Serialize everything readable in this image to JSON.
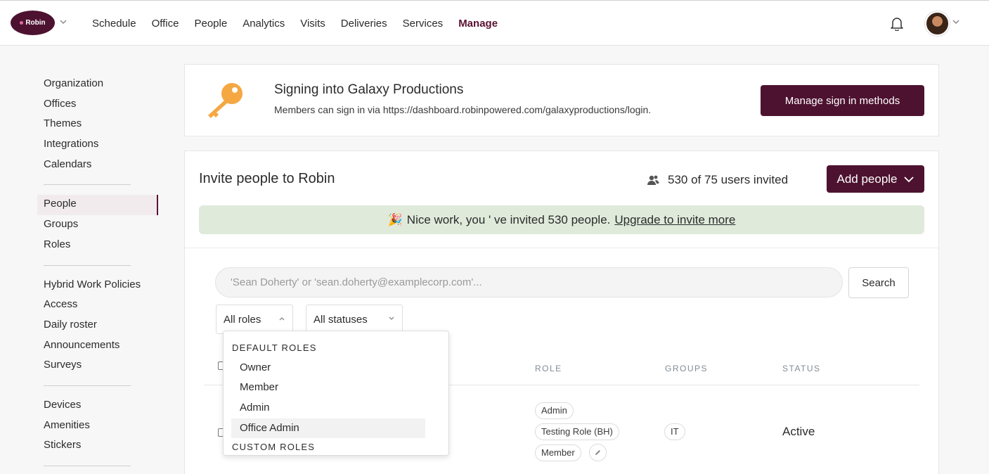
{
  "topnav": {
    "logo_text": "Robin",
    "items": [
      "Schedule",
      "Office",
      "People",
      "Analytics",
      "Visits",
      "Deliveries",
      "Services",
      "Manage"
    ],
    "active": "Manage"
  },
  "sidebar": {
    "groups": [
      [
        "Organization",
        "Offices",
        "Themes",
        "Integrations",
        "Calendars"
      ],
      [
        "People",
        "Groups",
        "Roles"
      ],
      [
        "Hybrid Work Policies",
        "Access",
        "Daily roster",
        "Announcements",
        "Surveys"
      ],
      [
        "Devices",
        "Amenities",
        "Stickers"
      ]
    ],
    "active": "People"
  },
  "signin": {
    "title": "Signing into Galaxy Productions",
    "subtitle": "Members can sign in via https://dashboard.robinpowered.com/galaxyproductions/login.",
    "button": "Manage sign in methods"
  },
  "invite": {
    "title": "Invite people to Robin",
    "invited_count": "530 of 75 users invited",
    "add_button": "Add people",
    "banner_emoji": "🎉",
    "banner_text": "Nice work, you ' ve invited 530 people.",
    "banner_link": "Upgrade to invite more"
  },
  "search": {
    "placeholder": "'Sean Doherty' or 'sean.doherty@examplecorp.com'...",
    "button": "Search"
  },
  "filters": {
    "roles": "All roles",
    "statuses": "All statuses"
  },
  "table": {
    "headers": {
      "role": "ROLE",
      "groups": "GROUPS",
      "status": "STATUS"
    },
    "rows": [
      {
        "roles": [
          "Admin",
          "Testing Role (BH)",
          "Member"
        ],
        "groups": [
          "IT"
        ],
        "status": "Active"
      }
    ]
  },
  "roles_dropdown": {
    "default_heading": "DEFAULT ROLES",
    "default_roles": [
      "Owner",
      "Member",
      "Admin",
      "Office Admin"
    ],
    "custom_heading": "CUSTOM ROLES",
    "highlighted": "Office Admin"
  },
  "colors": {
    "brand": "#4d1230",
    "banner_bg": "#dfeadb",
    "active_side_bg": "#f1ebee"
  }
}
